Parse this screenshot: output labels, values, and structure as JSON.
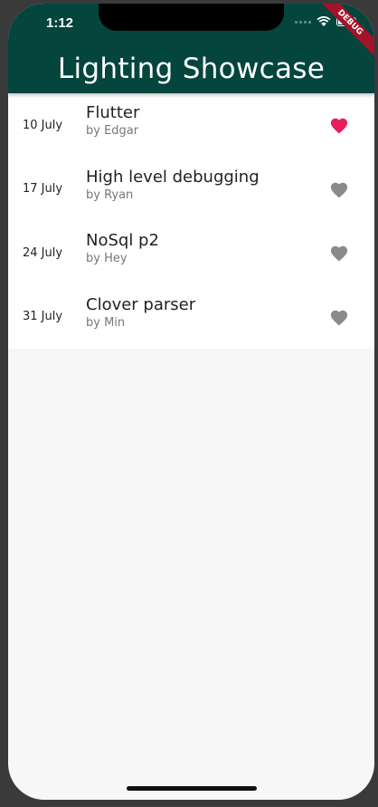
{
  "status_bar": {
    "time": "1:12"
  },
  "debug_banner": "DEBUG",
  "app_bar": {
    "title": "Lighting Showcase"
  },
  "colors": {
    "app_bar": "#04453e",
    "heart_active": "#ea1d5d",
    "heart_inactive": "#8a8a8a"
  },
  "talks": [
    {
      "date": "10 July",
      "title": "Flutter",
      "speaker": "by Edgar",
      "favorite": true,
      "icon": "heart-icon"
    },
    {
      "date": "17 July",
      "title": "High level debugging",
      "speaker": "by Ryan",
      "favorite": false,
      "icon": "heart-icon"
    },
    {
      "date": "24 July",
      "title": "NoSql p2",
      "speaker": "by Hey",
      "favorite": false,
      "icon": "heart-icon"
    },
    {
      "date": "31 July",
      "title": "Clover parser",
      "speaker": "by Min",
      "favorite": false,
      "icon": "heart-icon"
    }
  ]
}
